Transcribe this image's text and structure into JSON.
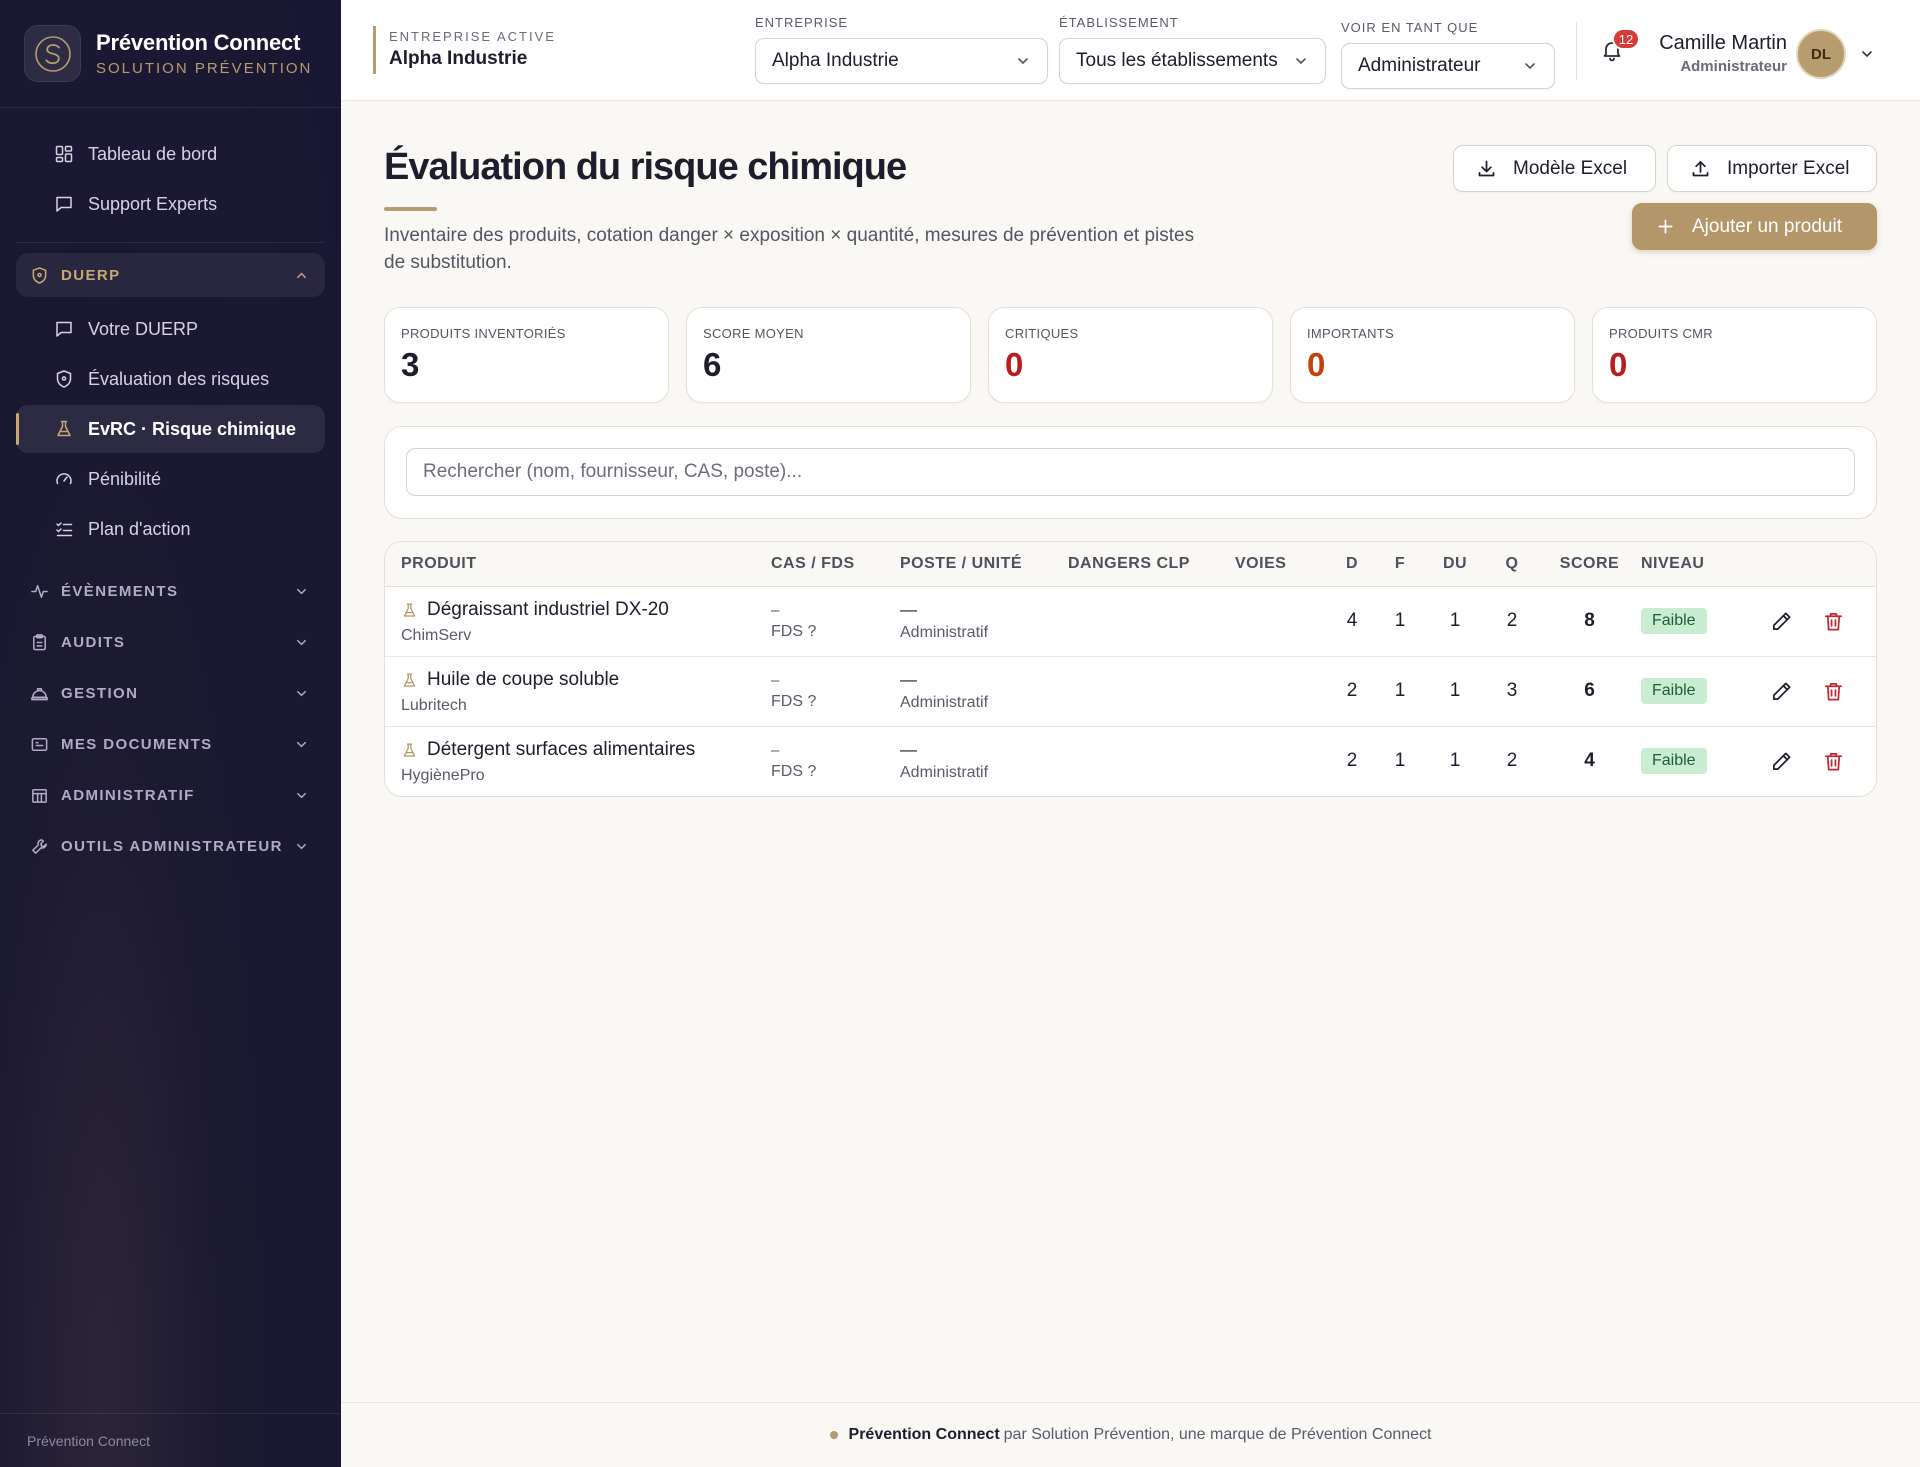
{
  "brand": {
    "name": "Prévention Connect",
    "subtitle": "SOLUTION PRÉVENTION"
  },
  "sidebar": {
    "top_items": [
      {
        "label": "Tableau de bord",
        "icon": "grid-icon"
      },
      {
        "label": "Support Experts",
        "icon": "message-icon"
      }
    ],
    "duerp_group": {
      "label": "DUERP",
      "items": [
        {
          "label": "Votre DUERP",
          "icon": "message-icon"
        },
        {
          "label": "Évaluation des risques",
          "icon": "shield-icon"
        },
        {
          "label": "EvRC · Risque chimique",
          "icon": "flask-icon",
          "active": true
        },
        {
          "label": "Pénibilité",
          "icon": "gauge-icon"
        },
        {
          "label": "Plan d'action",
          "icon": "checklist-icon"
        }
      ]
    },
    "groups": [
      {
        "label": "ÉVÈNEMENTS",
        "icon": "activity-icon"
      },
      {
        "label": "AUDITS",
        "icon": "clipboard-icon"
      },
      {
        "label": "GESTION",
        "icon": "hardhat-icon"
      },
      {
        "label": "MES DOCUMENTS",
        "icon": "folder-icon"
      },
      {
        "label": "ADMINISTRATIF",
        "icon": "building-icon"
      },
      {
        "label": "OUTILS ADMINISTRATEUR",
        "icon": "wrench-icon"
      }
    ],
    "footer": "Prévention Connect"
  },
  "header": {
    "active_company_label": "ENTREPRISE ACTIVE",
    "active_company": "Alpha Industrie",
    "entreprise_label": "ENTREPRISE",
    "entreprise_value": "Alpha Industrie",
    "etablissement_label": "ÉTABLISSEMENT",
    "etablissement_value": "Tous les établissements",
    "voir_label": "VOIR EN TANT QUE",
    "voir_value": "Administrateur",
    "notifications": "12",
    "user_name": "Camille Martin",
    "user_role": "Administrateur",
    "avatar_initials": "DL"
  },
  "main": {
    "title": "Évaluation du risque chimique",
    "description": "Inventaire des produits, cotation danger × exposition × quantité, mesures de prévention et pistes de substitution.",
    "btn_template": "Modèle Excel",
    "btn_import": "Importer Excel",
    "btn_add": "Ajouter un produit",
    "stats": [
      {
        "label": "PRODUITS INVENTORIÉS",
        "value": "3"
      },
      {
        "label": "SCORE MOYEN",
        "value": "6"
      },
      {
        "label": "CRITIQUES",
        "value": "0"
      },
      {
        "label": "IMPORTANTS",
        "value": "0"
      },
      {
        "label": "PRODUITS CMR",
        "value": "0"
      }
    ],
    "search_placeholder": "Rechercher (nom, fournisseur, CAS, poste)...",
    "table": {
      "headers": [
        "PRODUIT",
        "CAS / FDS",
        "POSTE / UNITÉ",
        "DANGERS CLP",
        "VOIES",
        "D",
        "F",
        "DU",
        "Q",
        "SCORE",
        "NIVEAU"
      ],
      "rows": [
        {
          "name": "Dégraissant industriel DX-20",
          "supplier": "ChimServ",
          "cas": "–",
          "fds": "FDS ?",
          "poste": "—",
          "unit": "Administratif",
          "d": "4",
          "f": "1",
          "du": "1",
          "q": "2",
          "score": "8",
          "niveau": "Faible"
        },
        {
          "name": "Huile de coupe soluble",
          "supplier": "Lubritech",
          "cas": "–",
          "fds": "FDS ?",
          "poste": "—",
          "unit": "Administratif",
          "d": "2",
          "f": "1",
          "du": "1",
          "q": "3",
          "score": "6",
          "niveau": "Faible"
        },
        {
          "name": "Détergent surfaces alimentaires",
          "supplier": "HygiènePro",
          "cas": "–",
          "fds": "FDS ?",
          "poste": "—",
          "unit": "Administratif",
          "d": "2",
          "f": "1",
          "du": "1",
          "q": "2",
          "score": "4",
          "niveau": "Faible"
        }
      ]
    }
  },
  "footer": {
    "brand": "Prévention Connect",
    "text": "par Solution Prévention, une marque de Prévention Connect"
  },
  "colors": {
    "accent": "#b69c6e",
    "sidebar_bg": "#181632",
    "critical": "#b81d1d",
    "important": "#c2410c",
    "low_badge": "#c9ecd3"
  }
}
